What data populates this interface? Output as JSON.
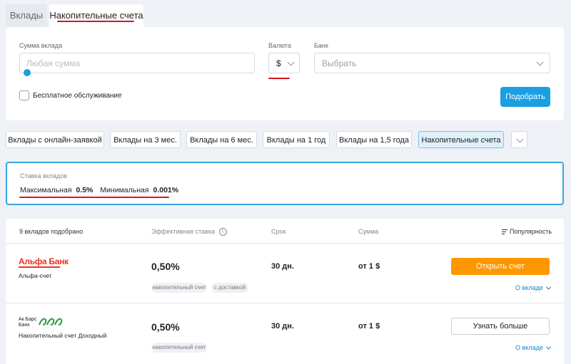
{
  "tabs": [
    {
      "label": "Вклады",
      "active": false
    },
    {
      "label": "Накопительные счета",
      "active": true
    }
  ],
  "filters": {
    "amount_label": "Сумма вклада",
    "amount_placeholder": "Любая сумма",
    "currency_label": "Валюта",
    "currency_value": "$",
    "bank_label": "Банк",
    "bank_placeholder": "Выбрать",
    "free_service_label": "Бесплатное обслуживание",
    "free_service_checked": false,
    "submit_label": "Подобрать"
  },
  "chips": [
    {
      "label": "Вклады с онлайн-заявкой",
      "active": false
    },
    {
      "label": "Вклады на 3 мес.",
      "active": false
    },
    {
      "label": "Вклады на 6 мес.",
      "active": false
    },
    {
      "label": "Вклады на 1 год",
      "active": false
    },
    {
      "label": "Вклады на 1,5 года",
      "active": false
    },
    {
      "label": "Накопительные счета",
      "active": true
    }
  ],
  "rates": {
    "title": "Ставка вкладов",
    "max_label": "Максимальная",
    "max_value": "0.5%",
    "min_label": "Минимальная",
    "min_value": "0.001%"
  },
  "results": {
    "count_label": "9 вкладов подобрано",
    "col_rate": "Эффективная ставка",
    "col_term": "Срок",
    "col_amount": "Сумма",
    "sort_label": "Популярность",
    "more_label": "О вкладе",
    "items": [
      {
        "bank_logo": "Альфа Банк",
        "product": "Альфа-счет",
        "rate": "0,50%",
        "term": "30 дн.",
        "amount": "от 1 $",
        "tags": [
          "накопительный счет",
          "с доставкой"
        ],
        "action": "Открыть счет"
      },
      {
        "bank_logo_line1": "Ак Барс",
        "bank_logo_line2": "Банк",
        "product": "Накопительный счет Доходный",
        "rate": "0,50%",
        "term": "30 дн.",
        "amount": "от 1 $",
        "tags": [
          "накопительный счет"
        ],
        "action": "Узнать больше"
      }
    ]
  },
  "colors": {
    "accent": "#1a9fe0",
    "orange": "#ff9800",
    "highlight": "#d9141e"
  }
}
